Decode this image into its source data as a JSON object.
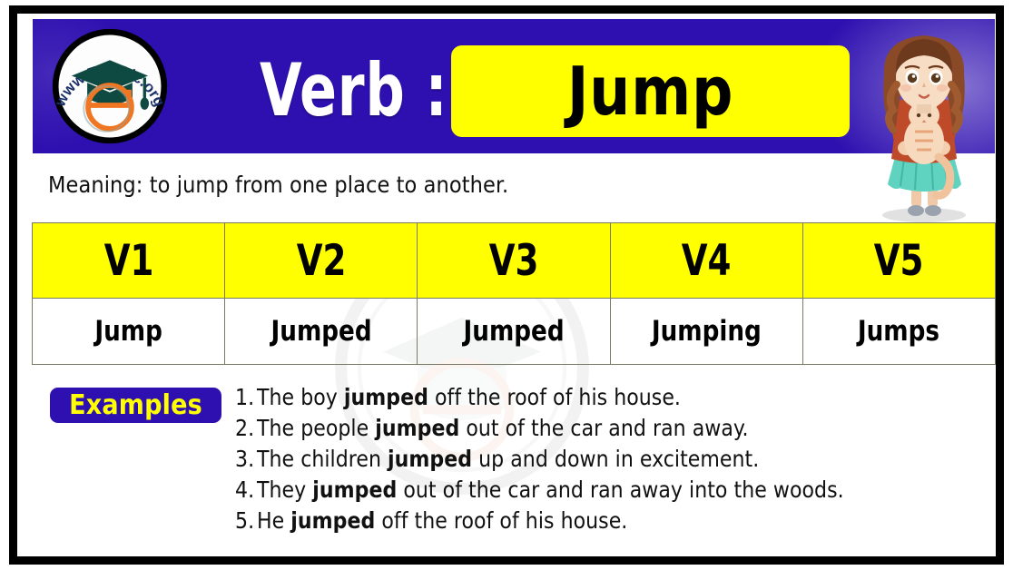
{
  "header": {
    "label": "Verb :",
    "verb": "Jump",
    "logo_alt": "www.EngDic.org",
    "logo_text": "www.EngDic.org",
    "illustration_alt": "girl holding a kitten"
  },
  "meaning": {
    "text": "Meaning: to jump from one place to another."
  },
  "table": {
    "headers": [
      "V1",
      "V2",
      "V3",
      "V4",
      "V5"
    ],
    "forms": [
      "Jump",
      "Jumped",
      "Jumped",
      "Jumping",
      "Jumps"
    ]
  },
  "examples": {
    "label": "Examples",
    "items": [
      {
        "num": "1.",
        "before": "The boy ",
        "bold": "jumped",
        "after": " off the roof of his house."
      },
      {
        "num": "2.",
        "before": "The people ",
        "bold": "jumped",
        "after": " out of the car and ran away."
      },
      {
        "num": "3.",
        "before": "The children ",
        "bold": "jumped",
        "after": " up and down in excitement."
      },
      {
        "num": "4.",
        "before": "They ",
        "bold": "jumped",
        "after": " out of the car and ran away into the woods."
      },
      {
        "num": "5.",
        "before": "He ",
        "bold": "jumped",
        "after": " off the roof of his house."
      }
    ]
  },
  "colors": {
    "brand_blue": "#2e10b0",
    "accent_yellow": "#ffff00",
    "frame_black": "#000000",
    "logo_orange": "#ef7622",
    "logo_teal": "#0e4a42"
  }
}
